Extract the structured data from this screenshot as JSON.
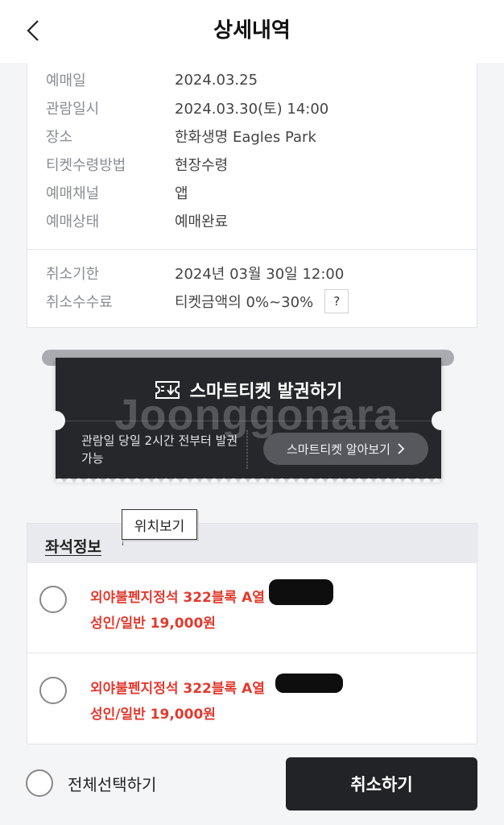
{
  "header": {
    "title": "상세내역"
  },
  "booking_info": [
    {
      "label": "예매일",
      "value": "2024.03.25"
    },
    {
      "label": "관람일시",
      "value": "2024.03.30(토) 14:00"
    },
    {
      "label": "장소",
      "value": "한화생명 Eagles Park"
    },
    {
      "label": "티켓수령방법",
      "value": "현장수령"
    },
    {
      "label": "예매채널",
      "value": "앱"
    },
    {
      "label": "예매상태",
      "value": "예매완료"
    }
  ],
  "cancel_info": [
    {
      "label": "취소기한",
      "value": "2024년 03월 30일 12:00"
    },
    {
      "label": "취소수수료",
      "value": "티켓금액의 0%~30%",
      "help": "?"
    }
  ],
  "smart_ticket": {
    "title": "스마트티켓 발권하기",
    "watermark": "Joonggonara",
    "note": "관람일 당일 2시간 전부터 발권 가능",
    "learn_more": "스마트티켓 알아보기"
  },
  "seat_section": {
    "title": "좌석정보",
    "tooltip": "위치보기",
    "seats": [
      {
        "name": "외야불펜지정석 322블록 A열",
        "price": "성인/일반 19,000원"
      },
      {
        "name": "외야불펜지정석 322블록 A열",
        "price": "성인/일반 19,000원"
      }
    ]
  },
  "footer": {
    "select_all": "전체선택하기",
    "cancel_button": "취소하기"
  }
}
